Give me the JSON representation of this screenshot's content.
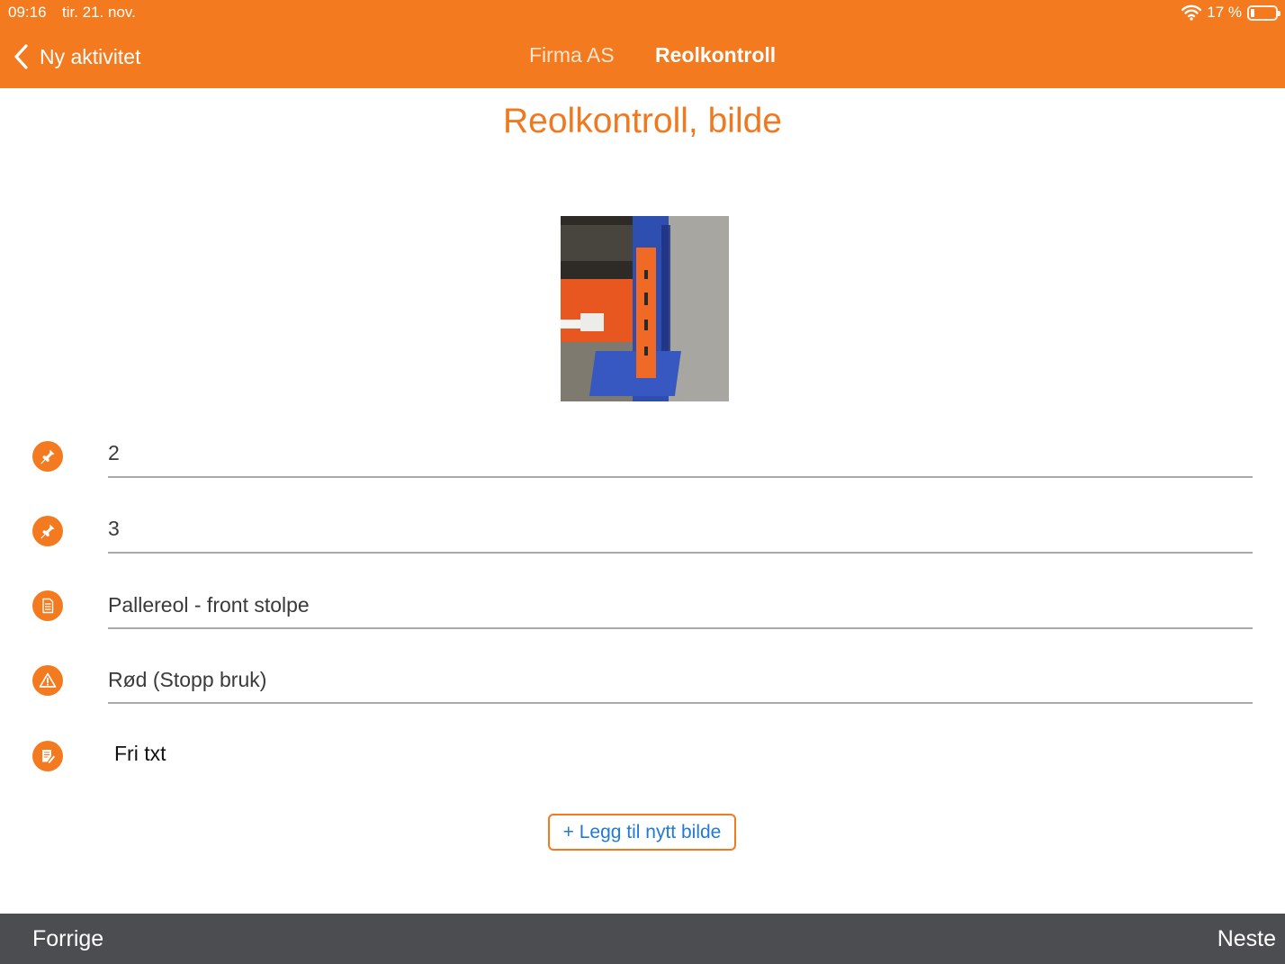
{
  "status_bar": {
    "time": "09:16",
    "date": "tir. 21. nov.",
    "battery": "17 %"
  },
  "nav": {
    "back_label": "Ny aktivitet",
    "company": "Firma AS",
    "current": "Reolkontroll"
  },
  "page": {
    "title": "Reolkontroll, bilde"
  },
  "fields": [
    {
      "icon": "pin-icon",
      "value": "2"
    },
    {
      "icon": "pin-icon",
      "value": "3"
    },
    {
      "icon": "checklist-icon",
      "value": "Pallereol - front stolpe"
    },
    {
      "icon": "warning-icon",
      "value": "Rød (Stopp bruk)"
    },
    {
      "icon": "note-edit-icon",
      "value": "Fri txt"
    }
  ],
  "actions": {
    "add_image": "+ Legg til nytt bilde"
  },
  "footer": {
    "prev": "Forrige",
    "next": "Neste"
  },
  "colors": {
    "accent": "#f37a1f",
    "title": "#f0781e",
    "link": "#1f7ad9",
    "footer": "#4c4d51"
  }
}
